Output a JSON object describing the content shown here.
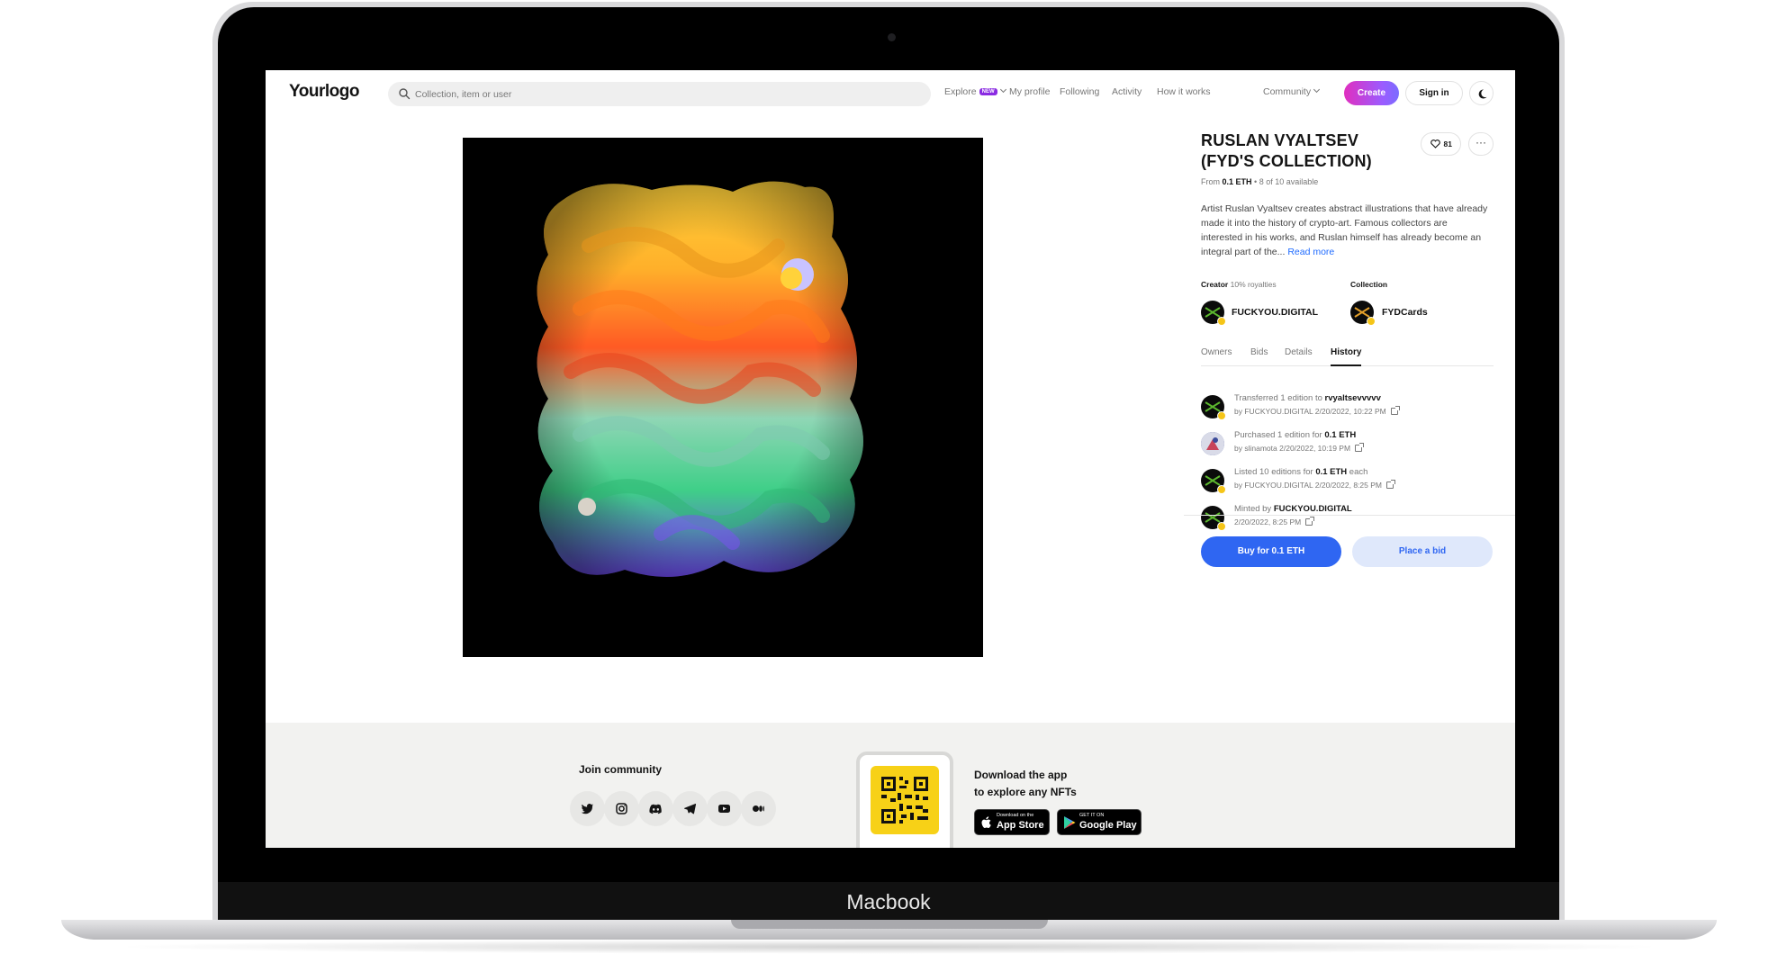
{
  "device_label": "Macbook",
  "header": {
    "logo": "Yourlogo",
    "search_placeholder": "Collection, item or user",
    "nav": {
      "explore": "Explore",
      "explore_badge": "NEW",
      "my_profile": "My profile",
      "following": "Following",
      "activity": "Activity",
      "how_it_works": "How it works",
      "community": "Community"
    },
    "create_label": "Create",
    "signin_label": "Sign in"
  },
  "item": {
    "title": "RUSLAN VYALTSEV (FYD'S COLLECTION)",
    "likes": "81",
    "from_label": "From",
    "price": "0.1 ETH",
    "availability": "8 of 10 available",
    "description": "Artist Ruslan Vyaltsev creates abstract illustrations that have already made it into the history of crypto-art. Famous collectors are interested in his works, and Ruslan himself has already become an integral part of the...",
    "read_more": "Read more",
    "creator_label": "Creator",
    "royalties": "10% royalties",
    "creator_name": "FUCKYOU.DIGITAL",
    "collection_label": "Collection",
    "collection_name": "FYDCards"
  },
  "tabs": [
    "Owners",
    "Bids",
    "Details",
    "History"
  ],
  "active_tab": "History",
  "history": [
    {
      "pre": "Transferred 1 edition to ",
      "strong": "rvyaltsevvvvv",
      "post": "",
      "by": "FUCKYOU.DIGITAL",
      "date": "2/20/2022, 10:22 PM",
      "avatar": "fyd"
    },
    {
      "pre": "Purchased 1 edition for ",
      "strong": "0.1 ETH",
      "post": "",
      "by": "slinamota",
      "date": "2/20/2022, 10:19 PM",
      "avatar": "user"
    },
    {
      "pre": "Listed 10 editions for ",
      "strong": "0.1 ETH",
      "post": " each",
      "by": "FUCKYOU.DIGITAL",
      "date": "2/20/2022, 8:25 PM",
      "avatar": "fyd"
    },
    {
      "pre": "Minted by ",
      "strong": "FUCKYOU.DIGITAL",
      "post": "",
      "by": "",
      "date": "2/20/2022, 8:25 PM",
      "avatar": "fyd"
    }
  ],
  "by_prefix": "by",
  "actions": {
    "buy": "Buy for 0.1 ETH",
    "bid": "Place a bid"
  },
  "footer": {
    "join_title": "Join community",
    "social_icons": [
      "twitter-icon",
      "instagram-icon",
      "discord-icon",
      "telegram-icon",
      "youtube-icon",
      "medium-icon"
    ],
    "download_line1": "Download the app",
    "download_line2": "to explore any NFTs",
    "appstore_small": "Download on the",
    "appstore_big": "App Store",
    "googleplay_small": "GET IT ON",
    "googleplay_big": "Google Play"
  },
  "colors": {
    "accent_blue": "#2f66f2",
    "create_gradient_start": "#e02fbf",
    "create_gradient_end": "#7b6cff",
    "qr_yellow": "#f7d117"
  }
}
